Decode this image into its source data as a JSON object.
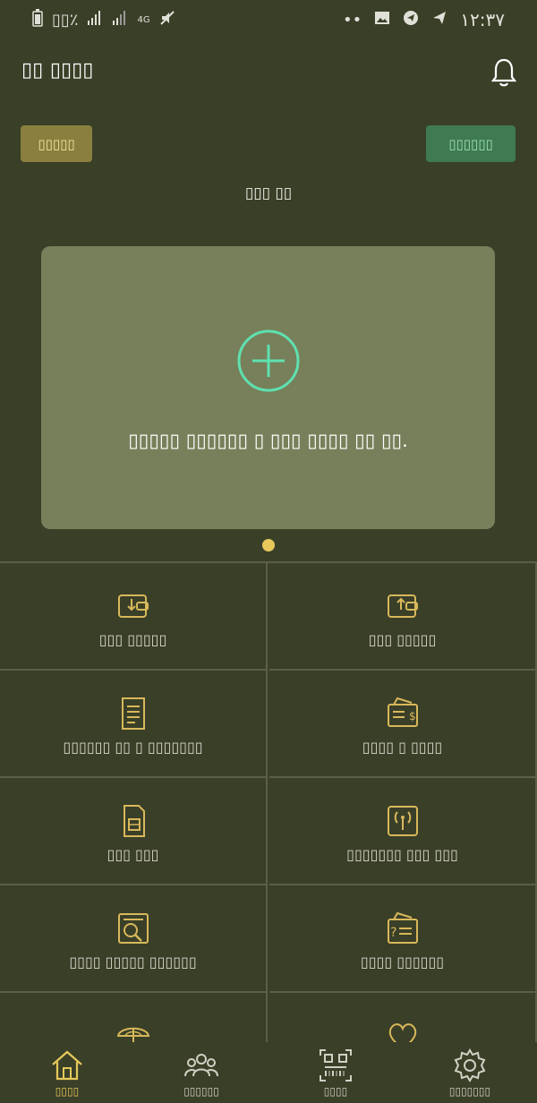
{
  "status_bar": {
    "battery": "▯▯٪",
    "network": "4G",
    "time": "۱۲:۳۷"
  },
  "header": {
    "app_title": "▯▯ ▯▯▯▯"
  },
  "buttons": {
    "left_label": "▯▯▯▯▯",
    "right_label": "▯▯▯▯▯▯"
  },
  "section_label": "▯▯▯ ▯▯",
  "card": {
    "add_text": "▯▯▯▯▯ ▯▯▯▯▯▯ ▯ ▯▯▯ ▯▯▯▯ ▯▯ ▯▯."
  },
  "grid": [
    {
      "label": "▯▯▯ ▯▯▯▯▯",
      "icon": "wallet-in-icon"
    },
    {
      "label": "▯▯▯ ▯▯▯▯▯",
      "icon": "wallet-out-icon"
    },
    {
      "label": "▯▯▯▯▯▯ ▯▯ ▯ ▯▯▯▯▯▯▯",
      "icon": "receipt-icon"
    },
    {
      "label": "▯▯▯▯ ▯ ▯▯▯▯",
      "icon": "bill-icon"
    },
    {
      "label": "▯▯▯ ▯▯▯",
      "icon": "sim-card-icon"
    },
    {
      "label": "▯▯▯▯▯▯▯ ▯▯▯ ▯▯▯",
      "icon": "internet-icon"
    },
    {
      "label": "▯▯▯▯ ▯▯▯▯▯ ▯▯▯▯▯▯",
      "icon": "search-document-icon"
    },
    {
      "label": "▯▯▯▯ ▯▯▯▯▯▯",
      "icon": "inquiry-icon"
    },
    {
      "label": "",
      "icon": "umbrella-icon"
    },
    {
      "label": "",
      "icon": "heart-icon"
    }
  ],
  "bottom_nav": [
    {
      "label": "▯▯▯▯",
      "icon": "home-icon",
      "active": true
    },
    {
      "label": "▯▯▯▯▯▯",
      "icon": "users-icon",
      "active": false
    },
    {
      "label": "▯▯▯▯",
      "icon": "qr-scan-icon",
      "active": false
    },
    {
      "label": "▯▯▯▯▯▯▯",
      "icon": "settings-icon",
      "active": false
    }
  ],
  "colors": {
    "background": "#3a3f28",
    "card": "#77805a",
    "accent_yellow": "#e6c95a",
    "accent_green": "#5fe0b0"
  }
}
